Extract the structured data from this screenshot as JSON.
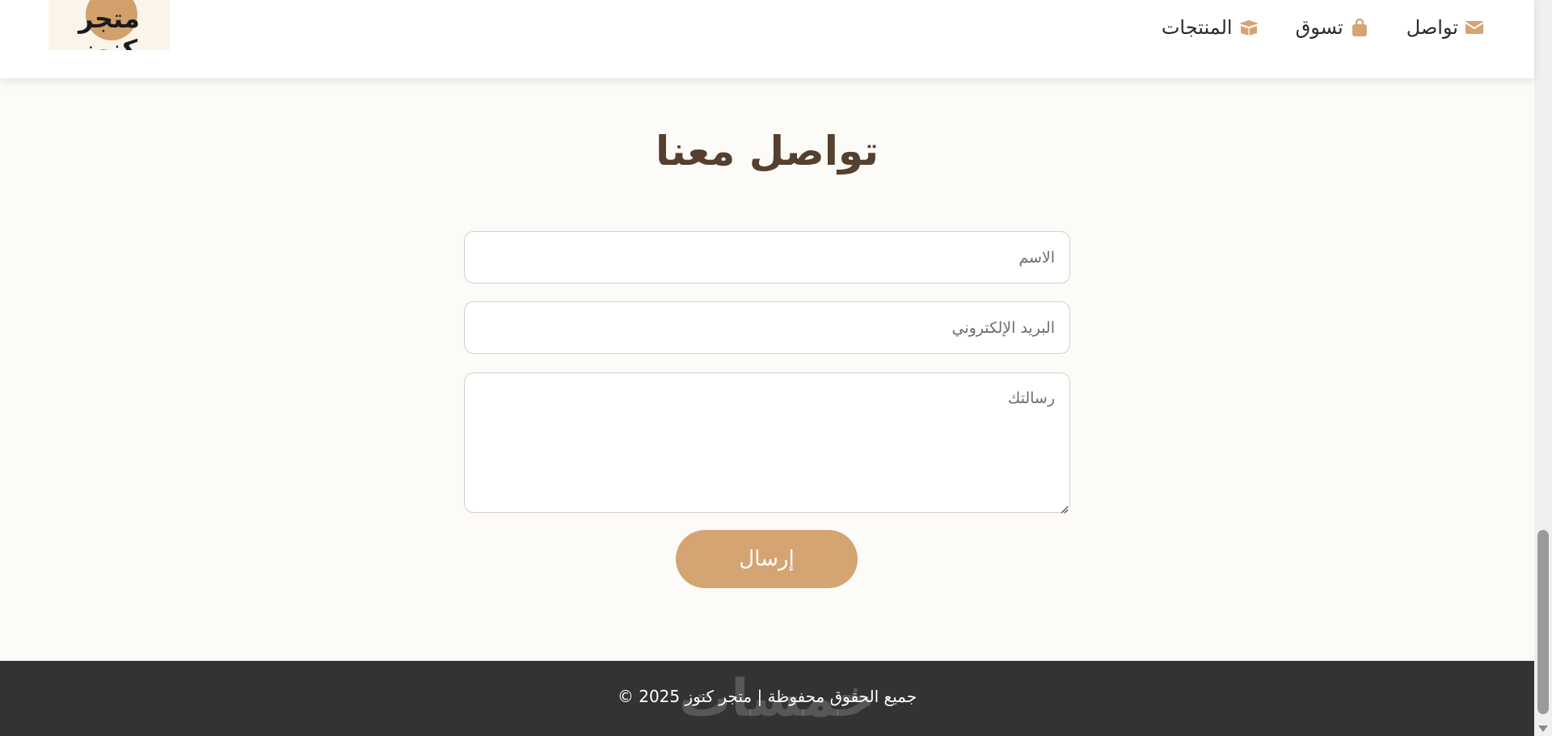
{
  "header": {
    "logo_text": "متجر كنوز",
    "nav": [
      {
        "label": "تواصل",
        "icon": "envelope-icon"
      },
      {
        "label": "تسوق",
        "icon": "shopping-bag-icon"
      },
      {
        "label": "المنتجات",
        "icon": "box-open-icon"
      }
    ]
  },
  "main": {
    "title": "تواصل معنا",
    "form": {
      "name_placeholder": "الاسم",
      "email_placeholder": "البريد الإلكتروني",
      "message_placeholder": "رسالتك",
      "submit_label": "إرسال"
    }
  },
  "footer": {
    "text": "جميع الحقوق محفوظة | متجر كنوز 2025 ©",
    "watermark": "خمسات"
  },
  "colors": {
    "accent": "#d4a473",
    "title": "#55402f",
    "page_bg": "#fcfbf8",
    "footer_bg": "#333333"
  }
}
